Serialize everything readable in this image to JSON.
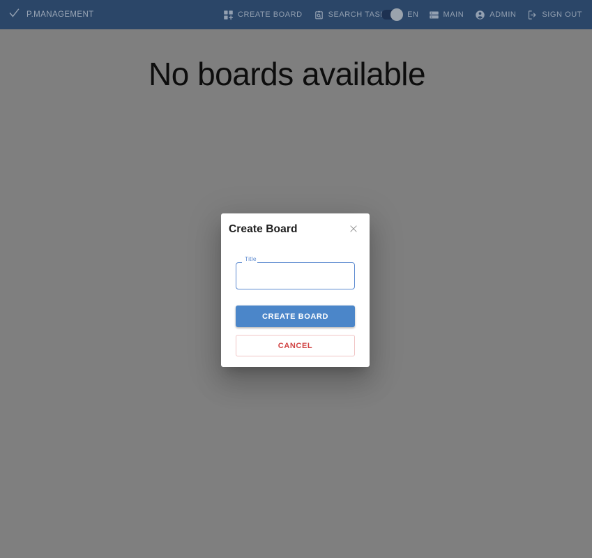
{
  "appbar": {
    "brand": {
      "icon": "check-icon",
      "label": "P.MANAGEMENT"
    },
    "center_items": [
      {
        "icon": "dashboard-add-icon",
        "label": "CREATE BOARD"
      },
      {
        "icon": "clipboard-search-icon",
        "label": "SEARCH TASK"
      }
    ],
    "language_toggle": {
      "state": "on",
      "label": "EN"
    },
    "right_items": [
      {
        "icon": "storage-icon",
        "label": "MAIN"
      },
      {
        "icon": "account-circle-icon",
        "label": "ADMIN"
      },
      {
        "icon": "logout-icon",
        "label": "SIGN OUT"
      }
    ]
  },
  "page": {
    "empty_message": "No boards available"
  },
  "dialog": {
    "title": "Create Board",
    "close_icon": "close-icon",
    "field": {
      "label": "Title",
      "value": "",
      "placeholder": ""
    },
    "submit_label": "CREATE BOARD",
    "cancel_label": "CANCEL"
  },
  "colors": {
    "appbar_bg": "#2b4668",
    "appbar_text": "#93a0b1",
    "primary": "#4b86c9",
    "danger": "#d14343",
    "field_border": "#5c8ad0",
    "backdrop": "rgba(0,0,0,0.5)"
  }
}
